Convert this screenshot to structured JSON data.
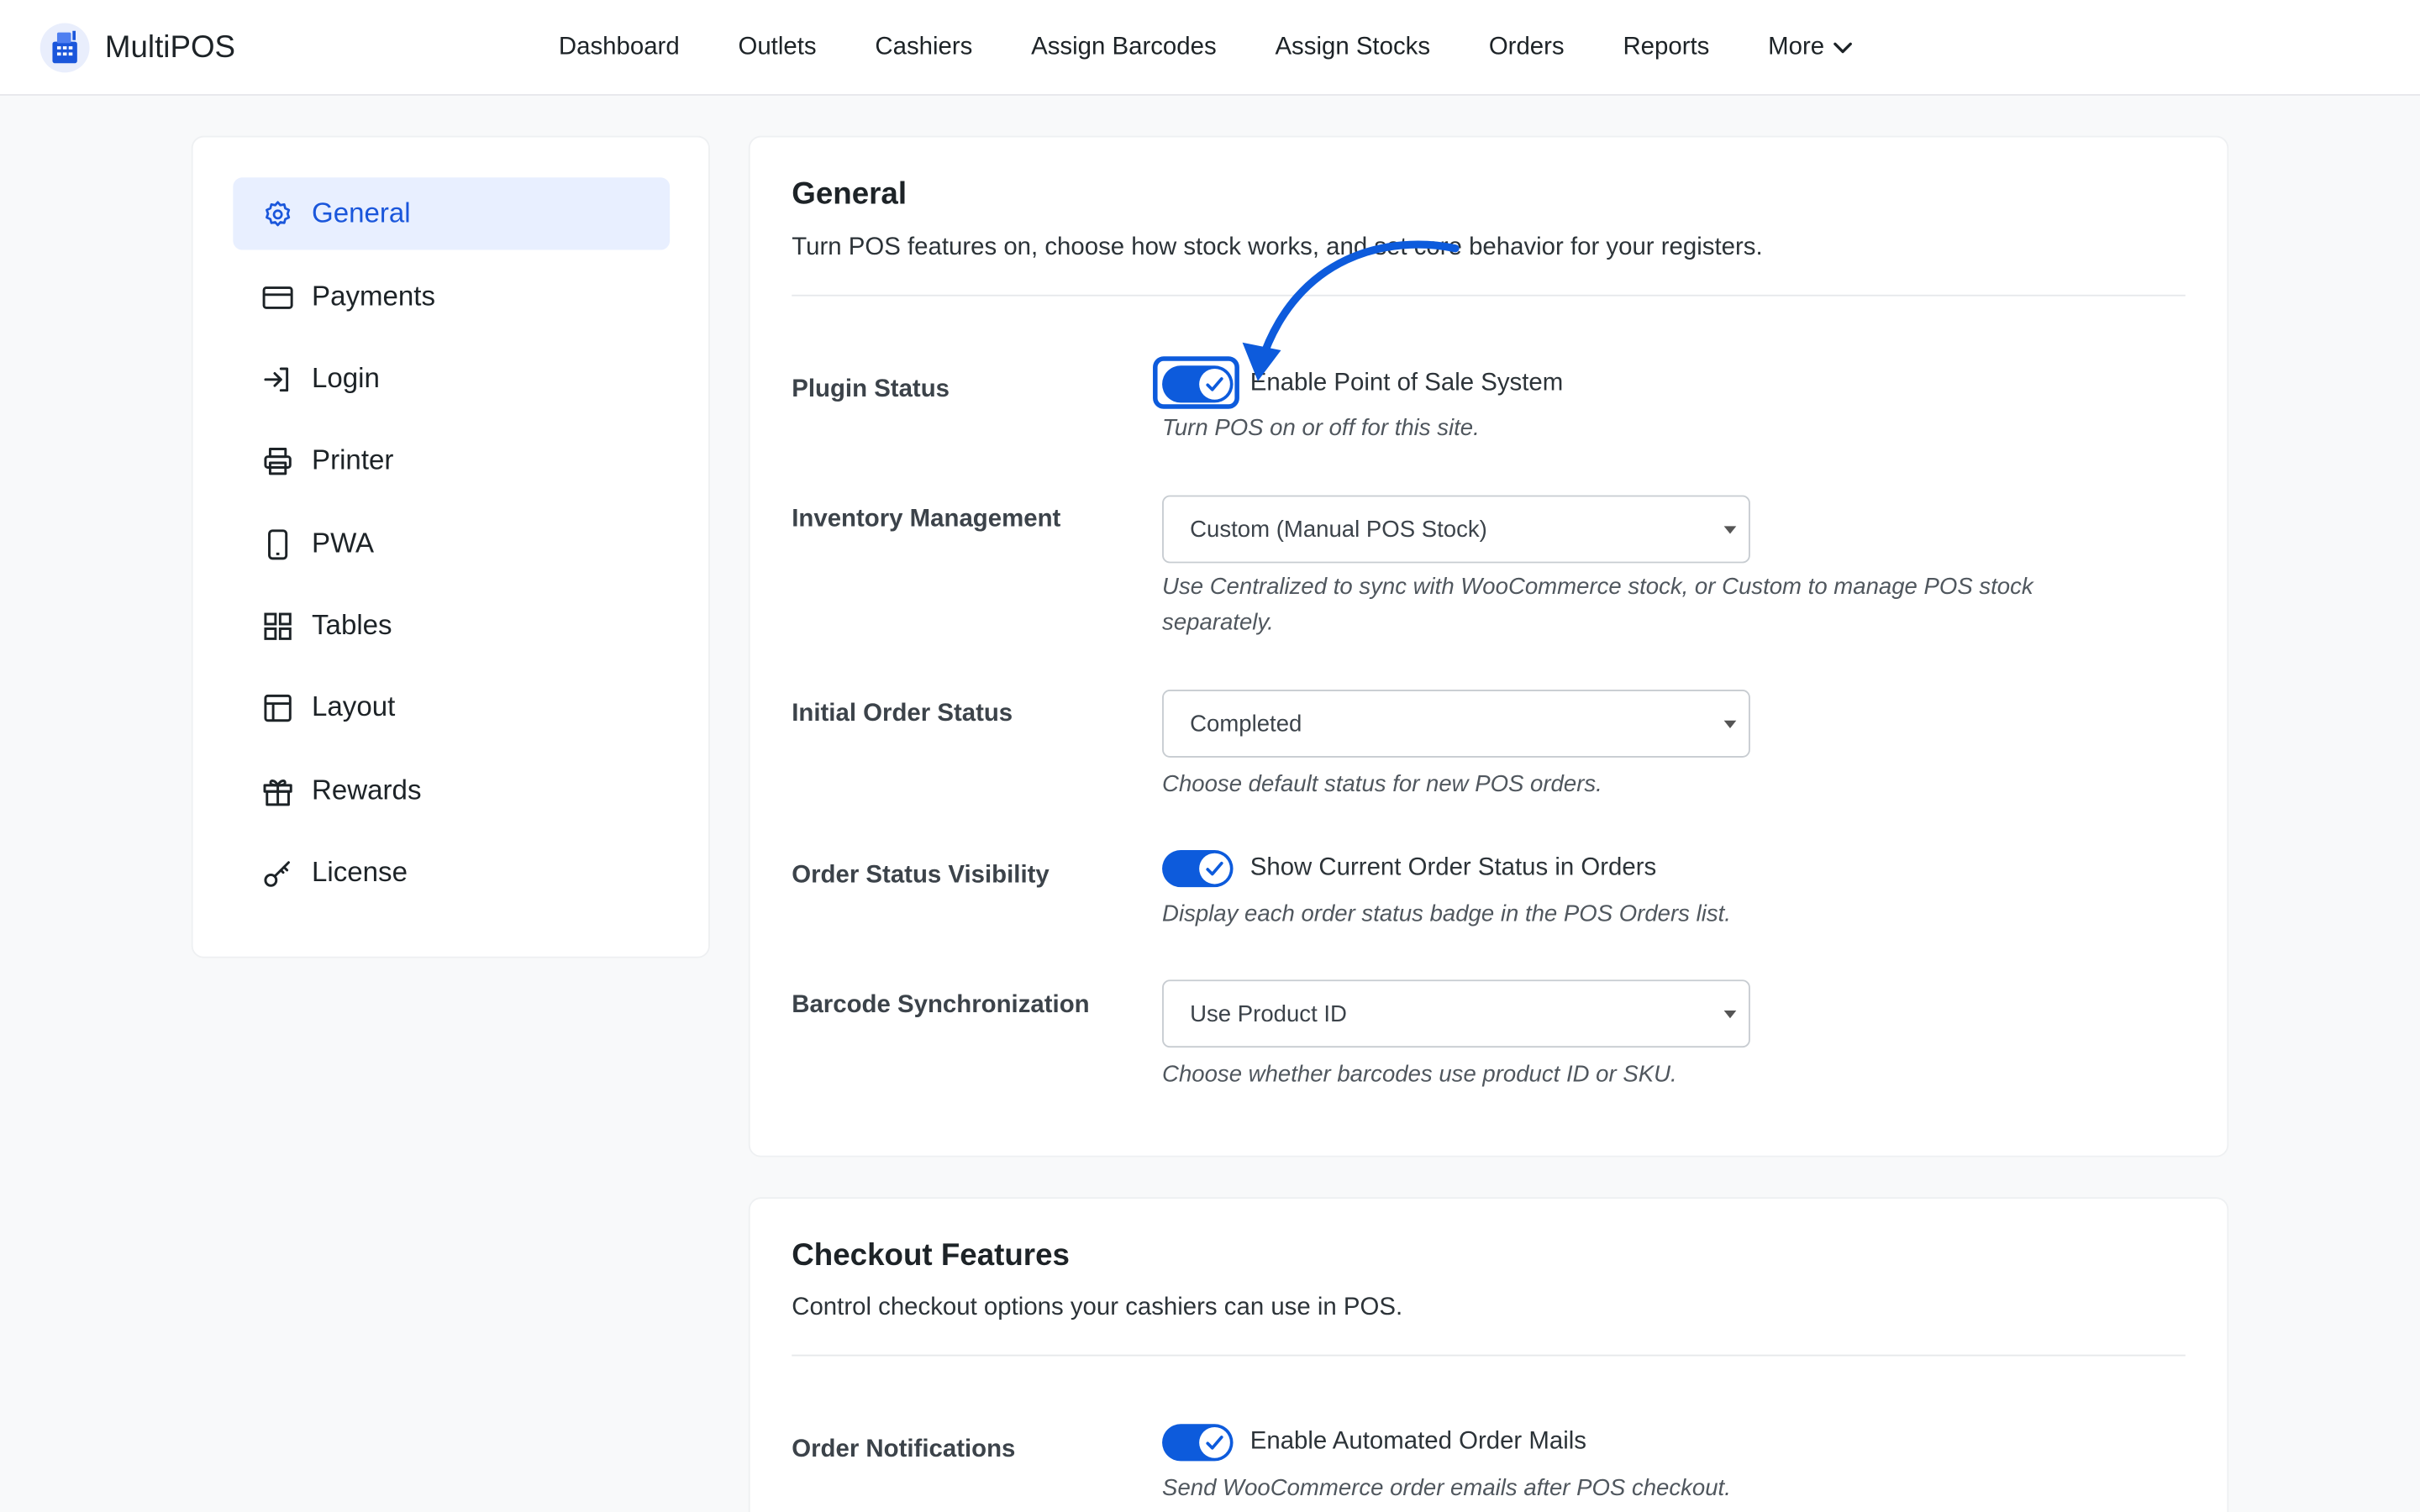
{
  "app": {
    "name": "MultiPOS"
  },
  "nav": {
    "items": [
      "Dashboard",
      "Outlets",
      "Cashiers",
      "Assign Barcodes",
      "Assign Stocks",
      "Orders",
      "Reports"
    ],
    "more_label": "More"
  },
  "sidebar": {
    "items": [
      {
        "label": "General",
        "icon": "gear-icon",
        "active": true
      },
      {
        "label": "Payments",
        "icon": "credit-card-icon"
      },
      {
        "label": "Login",
        "icon": "login-icon"
      },
      {
        "label": "Printer",
        "icon": "printer-icon"
      },
      {
        "label": "PWA",
        "icon": "mobile-icon"
      },
      {
        "label": "Tables",
        "icon": "grid-icon"
      },
      {
        "label": "Layout",
        "icon": "layout-icon"
      },
      {
        "label": "Rewards",
        "icon": "gift-icon"
      },
      {
        "label": "License",
        "icon": "key-icon"
      }
    ]
  },
  "general": {
    "title": "General",
    "subtitle": "Turn POS features on, choose how stock works, and set core behavior for your registers.",
    "plugin_status": {
      "label": "Plugin Status",
      "toggle_label": "Enable Point of Sale System",
      "enabled": true,
      "help": "Turn POS on or off for this site."
    },
    "inventory": {
      "label": "Inventory Management",
      "value": "Custom (Manual POS Stock)",
      "help": "Use Centralized to sync with WooCommerce stock, or Custom to manage POS stock separately."
    },
    "initial_order_status": {
      "label": "Initial Order Status",
      "value": "Completed",
      "help": "Choose default status for new POS orders."
    },
    "order_status_visibility": {
      "label": "Order Status Visibility",
      "toggle_label": "Show Current Order Status in Orders",
      "enabled": true,
      "help": "Display each order status badge in the POS Orders list."
    },
    "barcode_sync": {
      "label": "Barcode Synchronization",
      "value": "Use Product ID",
      "help": "Choose whether barcodes use product ID or SKU."
    }
  },
  "checkout": {
    "title": "Checkout Features",
    "subtitle": "Control checkout options your cashiers can use in POS.",
    "order_notifications": {
      "label": "Order Notifications",
      "toggle_label": "Enable Automated Order Mails",
      "enabled": true,
      "help": "Send WooCommerce order emails after POS checkout."
    }
  },
  "colors": {
    "accent": "#0d5bdc",
    "active_bg": "#e8efff",
    "active_text": "#1a56db"
  }
}
